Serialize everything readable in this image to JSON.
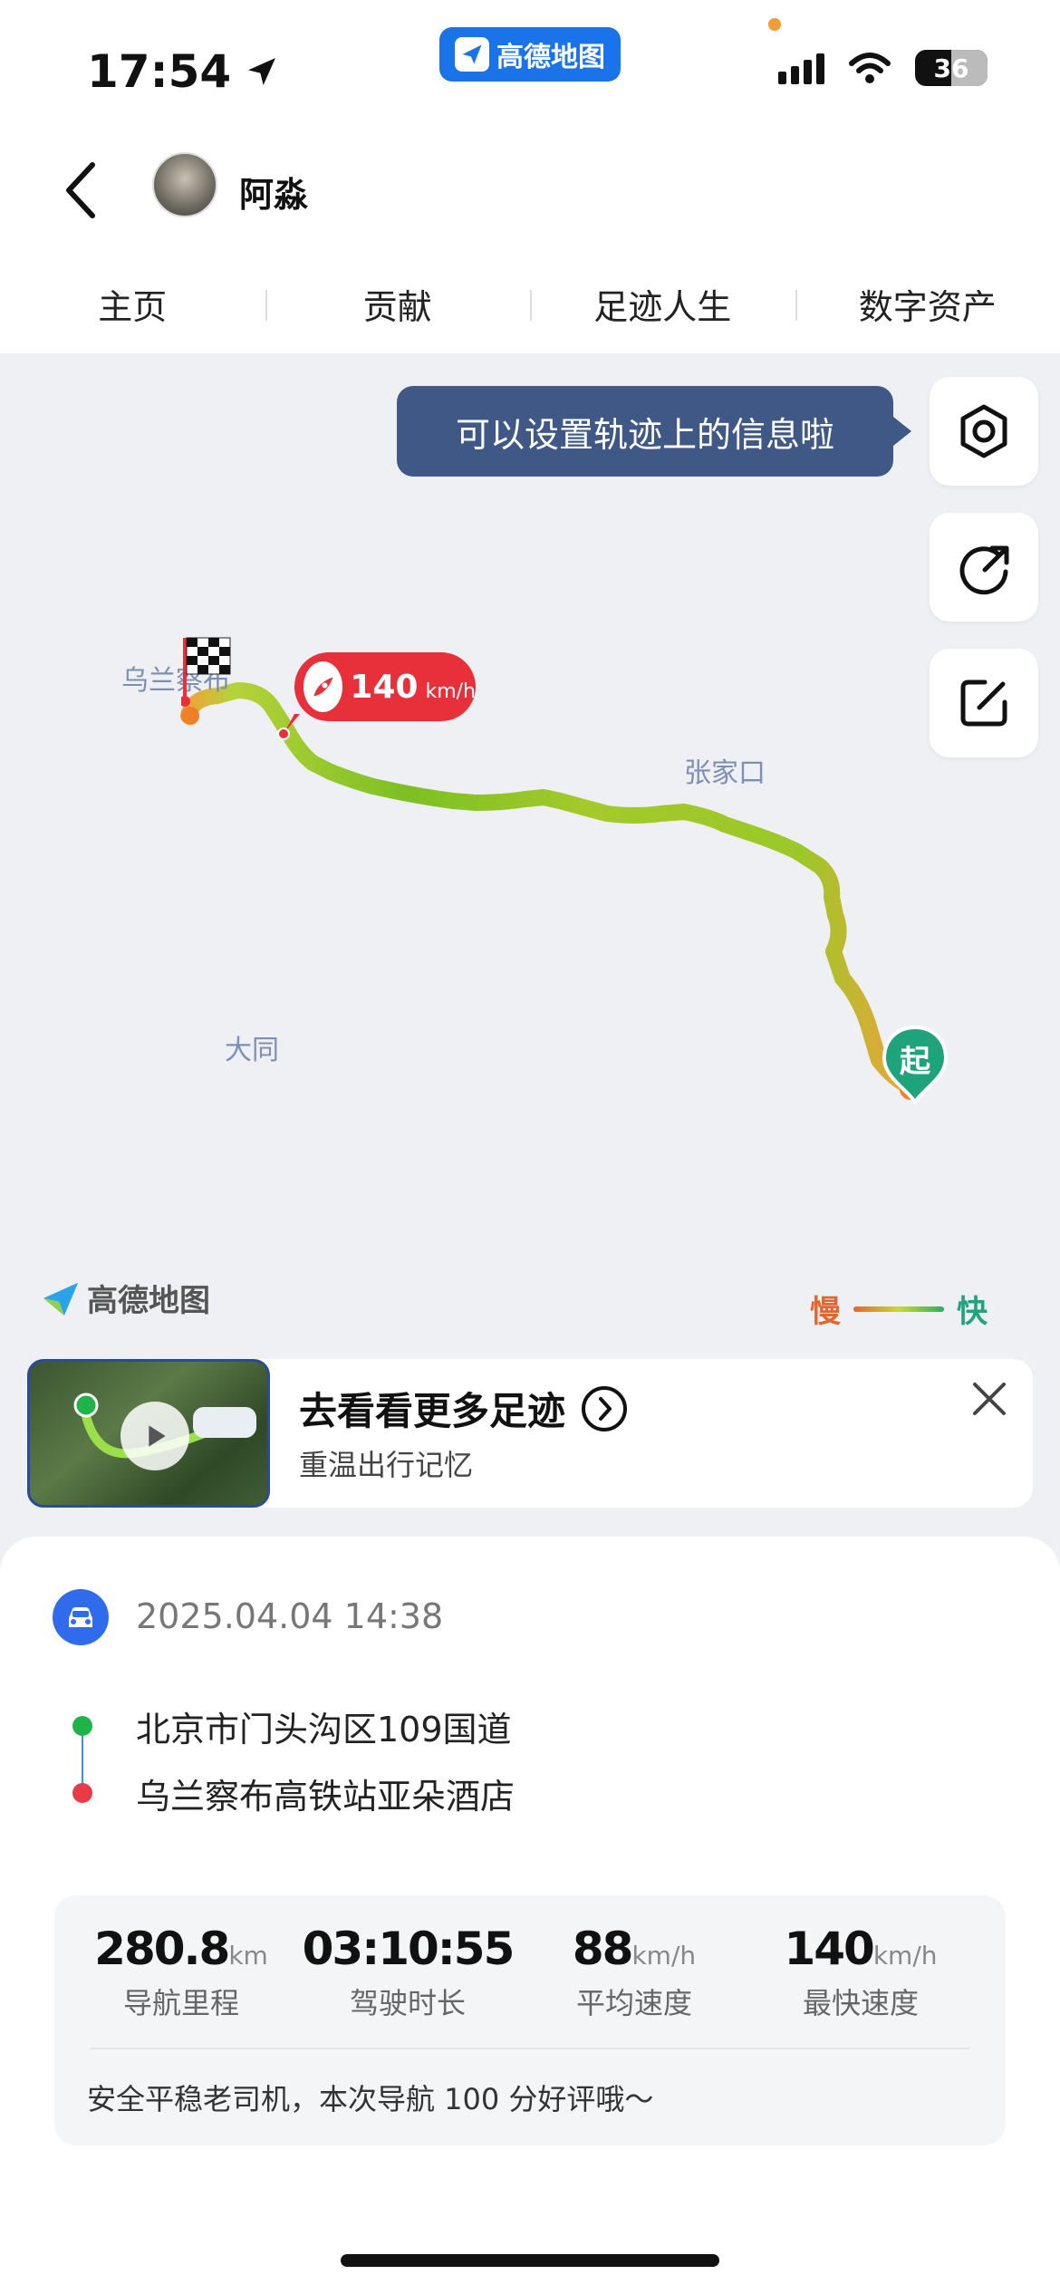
{
  "status_bar": {
    "time": "17:54",
    "app_name": "高德地图",
    "battery": "36"
  },
  "header": {
    "user_name": "阿淼"
  },
  "tabs": [
    {
      "label": "主页"
    },
    {
      "label": "贡献"
    },
    {
      "label": "足迹人生"
    },
    {
      "label": "数字资产"
    }
  ],
  "map": {
    "tooltip": "可以设置轨迹上的信息啦",
    "cities": {
      "ulanqab": "乌兰察布",
      "zhangjiakou": "张家口",
      "datong": "大同"
    },
    "max_speed_value": "140",
    "max_speed_unit": "km/h",
    "start_label": "起",
    "logo_text": "高德地图",
    "legend_slow": "慢",
    "legend_fast": "快",
    "icons": [
      "settings-icon",
      "share-icon",
      "edit-icon",
      "rocket-icon",
      "finish-flag-icon",
      "start-pin-icon"
    ]
  },
  "promo": {
    "title": "去看看更多足迹",
    "subtitle": "重温出行记忆"
  },
  "trip": {
    "datetime": "2025.04.04 14:38",
    "from": "北京市门头沟区109国道",
    "to": "乌兰察布高铁站亚朵酒店",
    "stats": [
      {
        "value": "280.8",
        "unit": "km",
        "label": "导航里程"
      },
      {
        "value": "03:10:55",
        "unit": "",
        "label": "驾驶时长"
      },
      {
        "value": "88",
        "unit": "km/h",
        "label": "平均速度"
      },
      {
        "value": "140",
        "unit": "km/h",
        "label": "最快速度"
      }
    ],
    "comment": "安全平稳老司机，本次导航 100 分好评哦～"
  },
  "colors": {
    "accent": "#2f6bea",
    "tooltip_bg": "#3f5886",
    "speed_badge": "#e8303b",
    "start_pin": "#1fa37a"
  }
}
